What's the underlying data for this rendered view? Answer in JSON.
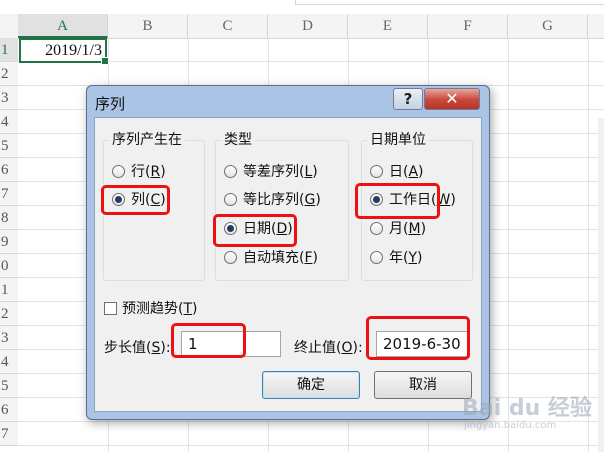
{
  "sheet": {
    "columns": [
      "A",
      "B",
      "C",
      "D",
      "E",
      "F",
      "G"
    ],
    "rows": [
      "1",
      "2",
      "3",
      "4",
      "5",
      "6",
      "7",
      "8",
      "9",
      "0",
      "1",
      "2",
      "3",
      "4",
      "5",
      "6",
      "7"
    ],
    "cell_a1": "2019/1/3"
  },
  "dialog": {
    "title": "序列",
    "help_label": "?",
    "close_label": "✕",
    "groups": {
      "series_in": {
        "label": "序列产生在",
        "options": [
          {
            "text": "行(",
            "key": "R",
            "close": ")",
            "selected": false
          },
          {
            "text": "列(",
            "key": "C",
            "close": ")",
            "selected": true
          }
        ]
      },
      "type": {
        "label": "类型",
        "options": [
          {
            "text": "等差序列(",
            "key": "L",
            "close": ")",
            "selected": false
          },
          {
            "text": "等比序列(",
            "key": "G",
            "close": ")",
            "selected": false
          },
          {
            "text": "日期(",
            "key": "D",
            "close": ")",
            "selected": true
          },
          {
            "text": "自动填充(",
            "key": "F",
            "close": ")",
            "selected": false
          }
        ]
      },
      "date_unit": {
        "label": "日期单位",
        "options": [
          {
            "text": "日(",
            "key": "A",
            "close": ")",
            "selected": false
          },
          {
            "text": "工作日(",
            "key": "W",
            "close": ")",
            "selected": true
          },
          {
            "text": "月(",
            "key": "M",
            "close": ")",
            "selected": false
          },
          {
            "text": "年(",
            "key": "Y",
            "close": ")",
            "selected": false
          }
        ]
      }
    },
    "trend": {
      "text": "预测趋势(",
      "key": "T",
      "close": ")",
      "checked": false
    },
    "step": {
      "text": "步长值(",
      "key": "S",
      "close": "):",
      "value": "1"
    },
    "stop": {
      "text": "终止值(",
      "key": "O",
      "close": "):",
      "value": "2019-6-30"
    },
    "ok_label": "确定",
    "cancel_label": "取消"
  },
  "watermark": {
    "logo": "Bai du 经验",
    "sub": "jingyan.baidu.com"
  },
  "colors": {
    "highlight": "#ee1111",
    "excel_green": "#217346",
    "dialog_frame": "#a9c4e4"
  }
}
